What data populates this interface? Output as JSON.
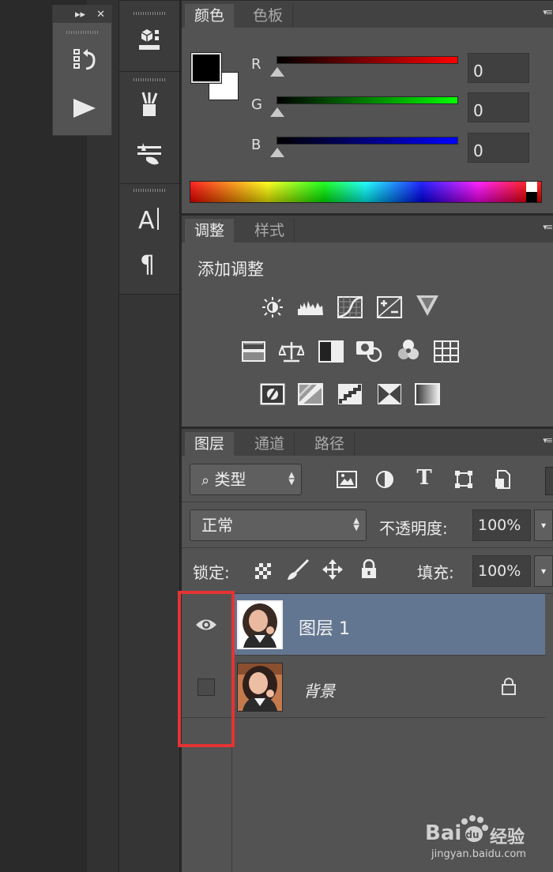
{
  "color_panel": {
    "tabs": [
      "颜色",
      "色板"
    ],
    "channels": [
      {
        "label": "R",
        "value": "0"
      },
      {
        "label": "G",
        "value": "0"
      },
      {
        "label": "B",
        "value": "0"
      }
    ],
    "foreground_color": "#000000",
    "background_color": "#ffffff"
  },
  "adjustments_panel": {
    "tabs": [
      "调整",
      "样式"
    ],
    "heading": "添加调整"
  },
  "layers_panel": {
    "tabs": [
      "图层",
      "通道",
      "路径"
    ],
    "filter_kind": "类型",
    "blend_mode": "正常",
    "opacity_label": "不透明度:",
    "opacity_value": "100%",
    "lock_label": "锁定:",
    "fill_label": "填充:",
    "fill_value": "100%",
    "layers": [
      {
        "name": "图层 1",
        "visible": true,
        "selected": true
      },
      {
        "name": "背景",
        "visible": false,
        "selected": false,
        "locked": true
      }
    ]
  },
  "tools": [
    "3d-material-icon",
    "brush-preset-icon",
    "brush-settings-icon",
    "character-icon",
    "paragraph-icon"
  ],
  "mini_panel": [
    "history-icon",
    "actions-play-icon"
  ],
  "watermark": {
    "brand": "Bai",
    "brand2": "经验",
    "url": "jingyan.baidu.com"
  },
  "colors": {
    "selected_row": "#637691",
    "highlight_box": "#e53333"
  }
}
